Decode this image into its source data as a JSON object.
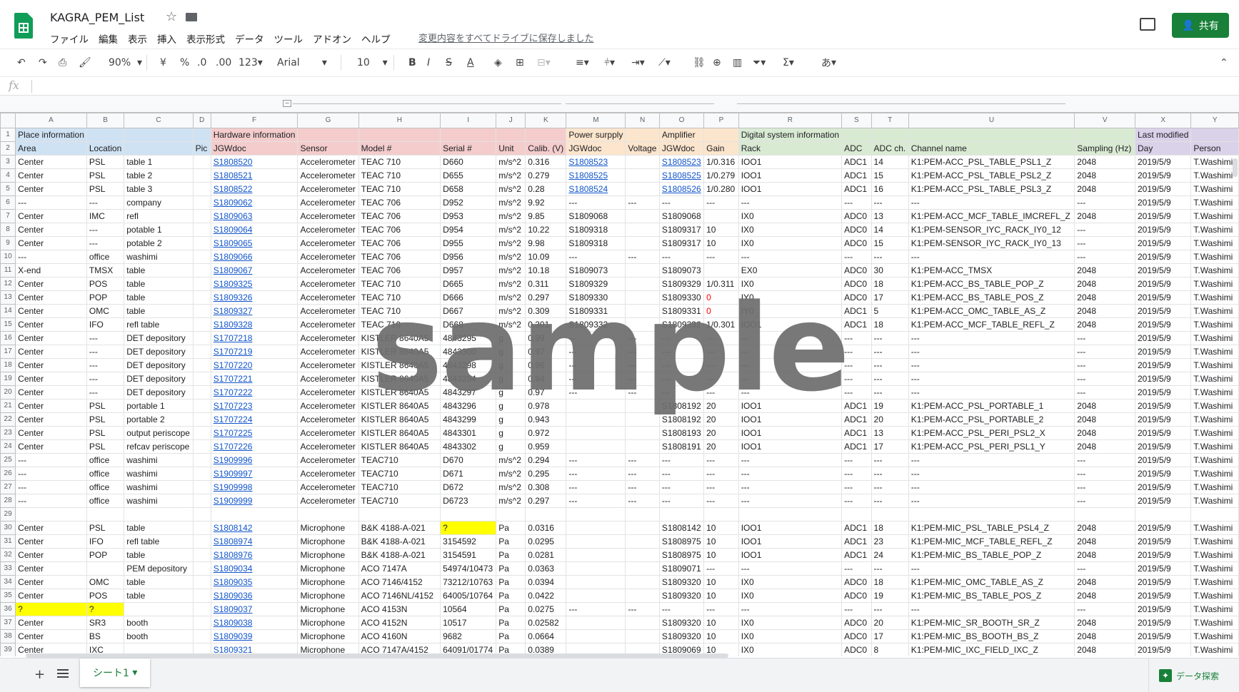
{
  "doc": {
    "title": "KAGRA_PEM_List",
    "save_status": "変更内容をすべてドライブに保存しました",
    "share_label": "共有"
  },
  "menu": [
    "ファイル",
    "編集",
    "表示",
    "挿入",
    "表示形式",
    "データ",
    "ツール",
    "アドオン",
    "ヘルプ"
  ],
  "toolbar": {
    "zoom": "90%",
    "currency": "¥",
    "percent": "%",
    "dec_less": ".0",
    "dec_more": ".00",
    "format": "123",
    "font": "Arial",
    "font_size": "10",
    "input_method": "あ"
  },
  "formula": {
    "fx": "fx"
  },
  "columns": [
    "A",
    "B",
    "C",
    "D",
    "F",
    "G",
    "H",
    "I",
    "J",
    "K",
    "M",
    "N",
    "O",
    "P",
    "R",
    "S",
    "T",
    "U",
    "V",
    "X",
    "Y"
  ],
  "header_rows": [
    [
      "Place information",
      "",
      "",
      "",
      "Hardware information",
      "",
      "",
      "",
      "",
      "",
      "Power surpply",
      "",
      "Amplifier",
      "",
      "Digital system information",
      "",
      "",
      "",
      "",
      "Last modified",
      ""
    ],
    [
      "Area",
      "Location",
      "",
      "Pic",
      "JGWdoc",
      "Sensor",
      "Model #",
      "Serial #",
      "Unit",
      "Calib. (V)",
      "JGWdoc",
      "Voltage",
      "JGWdoc",
      "Gain",
      "Rack",
      "ADC",
      "ADC ch.",
      "Channel name",
      "Sampling (Hz)",
      "Day",
      "Person"
    ]
  ],
  "rows": [
    [
      "3",
      "Center",
      "PSL",
      "table 1",
      "",
      "S1808520",
      "Accelerometer",
      "TEAC 710",
      "D660",
      "m/s^2",
      "0.316",
      "S1808523",
      "",
      "S1808523",
      "1/0.316",
      "IOO1",
      "ADC1",
      "14",
      "K1:PEM-ACC_PSL_TABLE_PSL1_Z",
      "2048",
      "2019/5/9",
      "T.Washimi"
    ],
    [
      "4",
      "Center",
      "PSL",
      "table 2",
      "",
      "S1808521",
      "Accelerometer",
      "TEAC 710",
      "D655",
      "m/s^2",
      "0.279",
      "S1808525",
      "",
      "S1808525",
      "1/0.279",
      "IOO1",
      "ADC1",
      "15",
      "K1:PEM-ACC_PSL_TABLE_PSL2_Z",
      "2048",
      "2019/5/9",
      "T.Washimi"
    ],
    [
      "5",
      "Center",
      "PSL",
      "table 3",
      "",
      "S1808522",
      "Accelerometer",
      "TEAC 710",
      "D658",
      "m/s^2",
      "0.28",
      "S1808524",
      "",
      "S1808526",
      "1/0.280",
      "IOO1",
      "ADC1",
      "16",
      "K1:PEM-ACC_PSL_TABLE_PSL3_Z",
      "2048",
      "2019/5/9",
      "T.Washimi"
    ],
    [
      "6",
      "---",
      "---",
      "company",
      "",
      "S1809062",
      "Accelerometer",
      "TEAC 706",
      "D952",
      "m/s^2",
      "9.92",
      "---",
      "---",
      "---",
      "---",
      "---",
      "---",
      "---",
      "---",
      "---",
      "2019/5/9",
      "T.Washimi"
    ],
    [
      "7",
      "Center",
      "IMC",
      "refl",
      "",
      "S1809063",
      "Accelerometer",
      "TEAC 706",
      "D953",
      "m/s^2",
      "9.85",
      "S1809068",
      "",
      "S1809068",
      "",
      "IX0",
      "ADC0",
      "13",
      "K1:PEM-ACC_MCF_TABLE_IMCREFL_Z",
      "2048",
      "2019/5/9",
      "T.Washimi"
    ],
    [
      "8",
      "Center",
      "---",
      "potable 1",
      "",
      "S1809064",
      "Accelerometer",
      "TEAC 706",
      "D954",
      "m/s^2",
      "10.22",
      "S1809318",
      "",
      "S1809317",
      "10",
      "IX0",
      "ADC0",
      "14",
      "K1:PEM-SENSOR_IYC_RACK_IY0_12",
      "---",
      "2019/5/9",
      "T.Washimi"
    ],
    [
      "9",
      "Center",
      "---",
      "potable 2",
      "",
      "S1809065",
      "Accelerometer",
      "TEAC 706",
      "D955",
      "m/s^2",
      "9.98",
      "S1809318",
      "",
      "S1809317",
      "10",
      "IX0",
      "ADC0",
      "15",
      "K1:PEM-SENSOR_IYC_RACK_IY0_13",
      "---",
      "2019/5/9",
      "T.Washimi"
    ],
    [
      "10",
      "---",
      "office",
      "washimi",
      "",
      "S1809066",
      "Accelerometer",
      "TEAC 706",
      "D956",
      "m/s^2",
      "10.09",
      "---",
      "---",
      "---",
      "---",
      "---",
      "---",
      "---",
      "---",
      "---",
      "2019/5/9",
      "T.Washimi"
    ],
    [
      "11",
      "X-end",
      "TMSX",
      "table",
      "",
      "S1809067",
      "Accelerometer",
      "TEAC 706",
      "D957",
      "m/s^2",
      "10.18",
      "S1809073",
      "",
      "S1809073",
      "",
      "EX0",
      "ADC0",
      "30",
      "K1:PEM-ACC_TMSX",
      "2048",
      "2019/5/9",
      "T.Washimi"
    ],
    [
      "12",
      "Center",
      "POS",
      "table",
      "",
      "S1809325",
      "Accelerometer",
      "TEAC 710",
      "D665",
      "m/s^2",
      "0.311",
      "S1809329",
      "",
      "S1809329",
      "1/0.311",
      "IX0",
      "ADC0",
      "18",
      "K1:PEM-ACC_BS_TABLE_POP_Z",
      "2048",
      "2019/5/9",
      "T.Washimi"
    ],
    [
      "13",
      "Center",
      "POP",
      "table",
      "",
      "S1809326",
      "Accelerometer",
      "TEAC 710",
      "D666",
      "m/s^2",
      "0.297",
      "S1809330",
      "",
      "S1809330",
      "0",
      "IY0",
      "ADC0",
      "17",
      "K1:PEM-ACC_BS_TABLE_POS_Z",
      "2048",
      "2019/5/9",
      "T.Washimi"
    ],
    [
      "14",
      "Center",
      "OMC",
      "table",
      "",
      "S1809327",
      "Accelerometer",
      "TEAC 710",
      "D667",
      "m/s^2",
      "0.309",
      "S1809331",
      "",
      "S1809331",
      "0",
      "IY0",
      "ADC1",
      "5",
      "K1:PEM-ACC_OMC_TABLE_AS_Z",
      "2048",
      "2019/5/9",
      "T.Washimi"
    ],
    [
      "15",
      "Center",
      "IFO",
      "refl table",
      "",
      "S1809328",
      "Accelerometer",
      "TEAC 710",
      "D668",
      "m/s^2",
      "0.301",
      "S1809332",
      "",
      "S1809332",
      "1/0.301",
      "IOO1",
      "ADC1",
      "18",
      "K1:PEM-ACC_MCF_TABLE_REFL_Z",
      "2048",
      "2019/5/9",
      "T.Washimi"
    ],
    [
      "16",
      "Center",
      "---",
      "DET depository",
      "",
      "S1707218",
      "Accelerometer",
      "KISTLER 8640A5",
      "4843295",
      "g",
      "0.99",
      "---",
      "---",
      "---",
      "---",
      "---",
      "---",
      "---",
      "---",
      "---",
      "2019/5/9",
      "T.Washimi"
    ],
    [
      "17",
      "Center",
      "---",
      "DET depository",
      "",
      "S1707219",
      "Accelerometer",
      "KISTLER 8640A5",
      "4843300",
      "g",
      "0.97",
      "---",
      "---",
      "---",
      "---",
      "---",
      "---",
      "---",
      "---",
      "---",
      "2019/5/9",
      "T.Washimi"
    ],
    [
      "18",
      "Center",
      "---",
      "DET depository",
      "",
      "S1707220",
      "Accelerometer",
      "KISTLER 8640A5",
      "4843298",
      "g",
      "0.96",
      "---",
      "---",
      "---",
      "---",
      "---",
      "---",
      "---",
      "---",
      "---",
      "2019/5/9",
      "T.Washimi"
    ],
    [
      "19",
      "Center",
      "---",
      "DET depository",
      "",
      "S1707221",
      "Accelerometer",
      "KISTLER 8640A5",
      "4843294",
      "g",
      "0.94",
      "---",
      "---",
      "---",
      "---",
      "---",
      "---",
      "---",
      "---",
      "---",
      "2019/5/9",
      "T.Washimi"
    ],
    [
      "20",
      "Center",
      "---",
      "DET depository",
      "",
      "S1707222",
      "Accelerometer",
      "KISTLER 8640A5",
      "4843297",
      "g",
      "0.97",
      "---",
      "---",
      "---",
      "---",
      "---",
      "---",
      "---",
      "---",
      "---",
      "2019/5/9",
      "T.Washimi"
    ],
    [
      "21",
      "Center",
      "PSL",
      "portable 1",
      "",
      "S1707223",
      "Accelerometer",
      "KISTLER 8640A5",
      "4843296",
      "g",
      "0.978",
      "",
      "",
      "S1808192",
      "20",
      "IOO1",
      "ADC1",
      "19",
      "K1:PEM-ACC_PSL_PORTABLE_1",
      "2048",
      "2019/5/9",
      "T.Washimi"
    ],
    [
      "22",
      "Center",
      "PSL",
      "portable 2",
      "",
      "S1707224",
      "Accelerometer",
      "KISTLER 8640A5",
      "4843299",
      "g",
      "0.943",
      "",
      "",
      "S1808192",
      "20",
      "IOO1",
      "ADC1",
      "20",
      "K1:PEM-ACC_PSL_PORTABLE_2",
      "2048",
      "2019/5/9",
      "T.Washimi"
    ],
    [
      "23",
      "Center",
      "PSL",
      "output periscope",
      "",
      "S1707225",
      "Accelerometer",
      "KISTLER 8640A5",
      "4843301",
      "g",
      "0.972",
      "",
      "",
      "S1808193",
      "20",
      "IOO1",
      "ADC1",
      "13",
      "K1:PEM-ACC_PSL_PERI_PSL2_X",
      "2048",
      "2019/5/9",
      "T.Washimi"
    ],
    [
      "24",
      "Center",
      "PSL",
      "refcav periscope",
      "",
      "S1707226",
      "Accelerometer",
      "KISTLER 8640A5",
      "4843302",
      "g",
      "0.959",
      "",
      "",
      "S1808191",
      "20",
      "IOO1",
      "ADC1",
      "17",
      "K1:PEM-ACC_PSL_PERI_PSL1_Y",
      "2048",
      "2019/5/9",
      "T.Washimi"
    ],
    [
      "25",
      "---",
      "office",
      "washimi",
      "",
      "S1909996",
      "Accelerometer",
      "TEAC710",
      "D670",
      "m/s^2",
      "0.294",
      "---",
      "---",
      "---",
      "---",
      "---",
      "---",
      "---",
      "---",
      "---",
      "2019/5/9",
      "T.Washimi"
    ],
    [
      "26",
      "---",
      "office",
      "washimi",
      "",
      "S1909997",
      "Accelerometer",
      "TEAC710",
      "D671",
      "m/s^2",
      "0.295",
      "---",
      "---",
      "---",
      "---",
      "---",
      "---",
      "---",
      "---",
      "---",
      "2019/5/9",
      "T.Washimi"
    ],
    [
      "27",
      "---",
      "office",
      "washimi",
      "",
      "S1909998",
      "Accelerometer",
      "TEAC710",
      "D672",
      "m/s^2",
      "0.308",
      "---",
      "---",
      "---",
      "---",
      "---",
      "---",
      "---",
      "---",
      "---",
      "2019/5/9",
      "T.Washimi"
    ],
    [
      "28",
      "---",
      "office",
      "washimi",
      "",
      "S1909999",
      "Accelerometer",
      "TEAC710",
      "D6723",
      "m/s^2",
      "0.297",
      "---",
      "---",
      "---",
      "---",
      "---",
      "---",
      "---",
      "---",
      "---",
      "2019/5/9",
      "T.Washimi"
    ],
    [
      "29",
      "",
      "",
      "",
      "",
      "",
      "",
      "",
      "",
      "",
      "",
      "",
      "",
      "",
      "",
      "",
      "",
      "",
      "",
      "",
      "",
      ""
    ],
    [
      "30",
      "Center",
      "PSL",
      "table",
      "",
      "S1808142",
      "Microphone",
      "B&K 4188-A-021",
      "?",
      "Pa",
      "0.0316",
      "",
      "",
      "S1808142",
      "10",
      "IOO1",
      "ADC1",
      "18",
      "K1:PEM-MIC_PSL_TABLE_PSL4_Z",
      "2048",
      "2019/5/9",
      "T.Washimi"
    ],
    [
      "31",
      "Center",
      "IFO",
      "refl table",
      "",
      "S1808974",
      "Microphone",
      "B&K 4188-A-021",
      "3154592",
      "Pa",
      "0.0295",
      "",
      "",
      "S1808975",
      "10",
      "IOO1",
      "ADC1",
      "23",
      "K1:PEM-MIC_MCF_TABLE_REFL_Z",
      "2048",
      "2019/5/9",
      "T.Washimi"
    ],
    [
      "32",
      "Center",
      "POP",
      "table",
      "",
      "S1808976",
      "Microphone",
      "B&K 4188-A-021",
      "3154591",
      "Pa",
      "0.0281",
      "",
      "",
      "S1808975",
      "10",
      "IOO1",
      "ADC1",
      "24",
      "K1:PEM-MIC_BS_TABLE_POP_Z",
      "2048",
      "2019/5/9",
      "T.Washimi"
    ],
    [
      "33",
      "Center",
      "",
      "PEM depository",
      "",
      "S1809034",
      "Microphone",
      "ACO 7147A",
      "54974/10473",
      "Pa",
      "0.0363",
      "",
      "",
      "S1809071",
      "---",
      "---",
      "---",
      "---",
      "---",
      "---",
      "2019/5/9",
      "T.Washimi"
    ],
    [
      "34",
      "Center",
      "OMC",
      "table",
      "",
      "S1809035",
      "Microphone",
      "ACO 7146/4152",
      "73212/10763",
      "Pa",
      "0.0394",
      "",
      "",
      "S1809320",
      "10",
      "IX0",
      "ADC0",
      "18",
      "K1:PEM-MIC_OMC_TABLE_AS_Z",
      "2048",
      "2019/5/9",
      "T.Washimi"
    ],
    [
      "35",
      "Center",
      "POS",
      "table",
      "",
      "S1809036",
      "Microphone",
      "ACO 7146NL/4152",
      "64005/10764",
      "Pa",
      "0.0422",
      "",
      "",
      "S1809320",
      "10",
      "IX0",
      "ADC0",
      "19",
      "K1:PEM-MIC_BS_TABLE_POS_Z",
      "2048",
      "2019/5/9",
      "T.Washimi"
    ],
    [
      "36",
      "?",
      "?",
      "",
      "",
      "S1809037",
      "Microphone",
      "ACO 4153N",
      "10564",
      "Pa",
      "0.0275",
      "---",
      "---",
      "---",
      "---",
      "---",
      "---",
      "---",
      "---",
      "---",
      "2019/5/9",
      "T.Washimi"
    ],
    [
      "37",
      "Center",
      "SR3",
      "booth",
      "",
      "S1809038",
      "Microphone",
      "ACO 4152N",
      "10517",
      "Pa",
      "0.02582",
      "",
      "",
      "S1809320",
      "10",
      "IX0",
      "ADC0",
      "20",
      "K1:PEM-MIC_SR_BOOTH_SR_Z",
      "2048",
      "2019/5/9",
      "T.Washimi"
    ],
    [
      "38",
      "Center",
      "BS",
      "booth",
      "",
      "S1809039",
      "Microphone",
      "ACO 4160N",
      "9682",
      "Pa",
      "0.0664",
      "",
      "",
      "S1809320",
      "10",
      "IX0",
      "ADC0",
      "17",
      "K1:PEM-MIC_BS_BOOTH_BS_Z",
      "2048",
      "2019/5/9",
      "T.Washimi"
    ],
    [
      "39",
      "Center",
      "IXC",
      "",
      "",
      "S1809321",
      "Microphone",
      "ACO 7147A/4152",
      "64091/01774",
      "Pa",
      "0.0389",
      "",
      "",
      "S1809069",
      "10",
      "IX0",
      "ADC0",
      "8",
      "K1:PEM-MIC_IXC_FIELD_IXC_Z",
      "2048",
      "2019/5/9",
      "T.Washimi"
    ]
  ],
  "sheet": {
    "tab": "シート1",
    "explore": "データ探索"
  },
  "watermark": "sample",
  "colors": {
    "place": "#cfe2f3",
    "hardware": "#f4cccc",
    "power": "#fce5cd",
    "amplifier": "#fce5cd",
    "digital": "#d9ead3",
    "modified": "#d9d2e9",
    "highlight": "#ffff00",
    "link": "#1155cc",
    "accent": "#188038"
  }
}
